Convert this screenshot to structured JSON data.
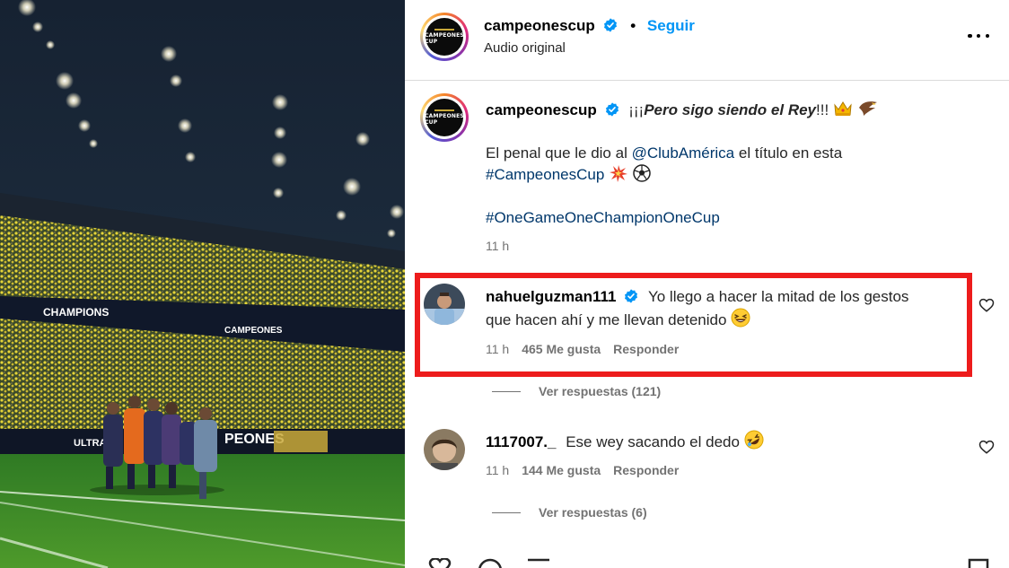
{
  "post": {
    "username": "campeonescup",
    "follow_label": "Seguir",
    "separator": "•",
    "audio": "Audio original",
    "logo_text": "CAMPEONES CUP"
  },
  "caption": {
    "username": "campeonescup",
    "text_prefix": "¡¡¡",
    "text_bold_italic": "Pero sigo siendo el Rey",
    "text_suffix": "!!!",
    "line2_prefix": "El penal que le dio al ",
    "line2_mention": "@ClubAmérica",
    "line2_suffix": " el título en esta",
    "hashtag1": "#CampeonesCup",
    "hashtag2": "#OneGameOneChampionOneCup",
    "time": "11 h"
  },
  "comments": [
    {
      "username": "nahuelguzman111",
      "verified": true,
      "text_line1": "Yo llego a hacer la mitad de los gestos",
      "text_line2": "que hacen ahí y me llevan detenido",
      "time": "11 h",
      "likes": "465 Me gusta",
      "reply_label": "Responder",
      "view_replies": "Ver respuestas (121)"
    },
    {
      "username": "1117007._",
      "verified": false,
      "text": "Ese wey sacando el dedo",
      "time": "11 h",
      "likes": "144 Me gusta",
      "reply_label": "Responder",
      "view_replies": "Ver respuestas (6)"
    }
  ],
  "media": {
    "banner_left": "CHAMPIONS",
    "banner_right": "CAMPEONES",
    "banner_far_right": "PEONES",
    "ad_left": "ULTRA"
  },
  "colors": {
    "link": "#00376b",
    "follow": "#0095f6",
    "verified": "#0095f6",
    "highlight": "#ed1c1c",
    "muted": "#737373"
  },
  "icons": [
    "verified-badge-icon",
    "more-options-icon",
    "heart-icon",
    "crown-emoji",
    "eagle-emoji",
    "collision-emoji",
    "soccer-ball-emoji",
    "laughing-emoji",
    "rolling-laughing-emoji"
  ]
}
